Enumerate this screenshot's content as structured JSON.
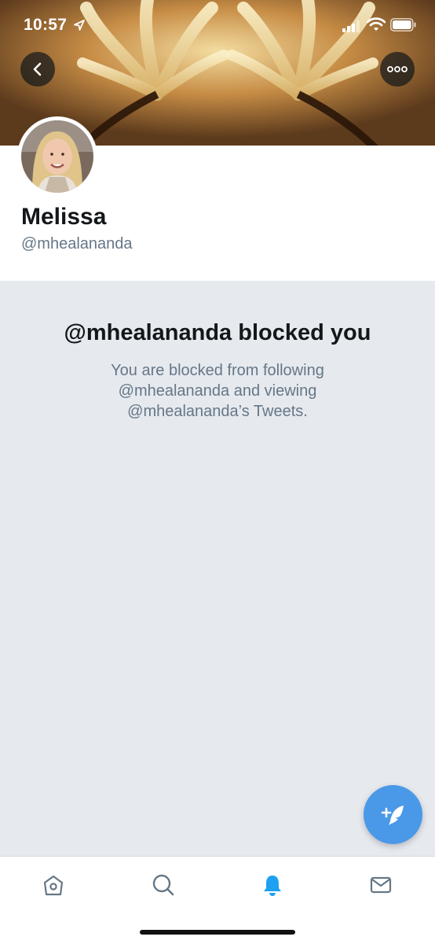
{
  "status_bar": {
    "time": "10:57",
    "icons": [
      "location-arrow-icon",
      "cellular-signal-icon",
      "wifi-icon",
      "battery-icon"
    ]
  },
  "header": {
    "back_icon": "chevron-left-icon",
    "more_icon": "more-horizontal-icon"
  },
  "profile": {
    "display_name": "Melissa",
    "handle": "@mhealananda"
  },
  "blocked_notice": {
    "title": "@mhealananda blocked you",
    "body": "You are blocked from following @mhealananda and viewing @mhealananda’s Tweets."
  },
  "compose_button": {
    "icon": "compose-tweet-icon"
  },
  "tab_bar": {
    "tabs": [
      {
        "name": "home",
        "icon": "home-icon",
        "active": false
      },
      {
        "name": "search",
        "icon": "search-icon",
        "active": false
      },
      {
        "name": "notifications",
        "icon": "bell-icon",
        "active": true
      },
      {
        "name": "messages",
        "icon": "envelope-icon",
        "active": false
      }
    ]
  },
  "colors": {
    "accent": "#1da1f2",
    "fab": "#4a99e9",
    "background": "#e6e9ee",
    "text_primary": "#14171a",
    "text_secondary": "#657786",
    "tab_inactive": "#657786"
  }
}
